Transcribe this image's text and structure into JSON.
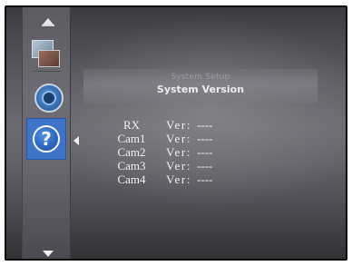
{
  "menu": {
    "parent_title": "System Setup",
    "title": "System Version",
    "items": [
      {
        "name": "photos",
        "icon": "photos-icon"
      },
      {
        "name": "settings",
        "icon": "gear-icon"
      },
      {
        "name": "help",
        "icon": "help-icon",
        "glyph": "?",
        "selected": true
      }
    ],
    "selected_color": "#3d73c9"
  },
  "versions": [
    {
      "device": "RX",
      "label": "Ver:",
      "value": "----"
    },
    {
      "device": "Cam1",
      "label": "Ver:",
      "value": "----"
    },
    {
      "device": "Cam2",
      "label": "Ver:",
      "value": "----"
    },
    {
      "device": "Cam3",
      "label": "Ver:",
      "value": "----"
    },
    {
      "device": "Cam4",
      "label": "Ver:",
      "value": "----"
    }
  ]
}
